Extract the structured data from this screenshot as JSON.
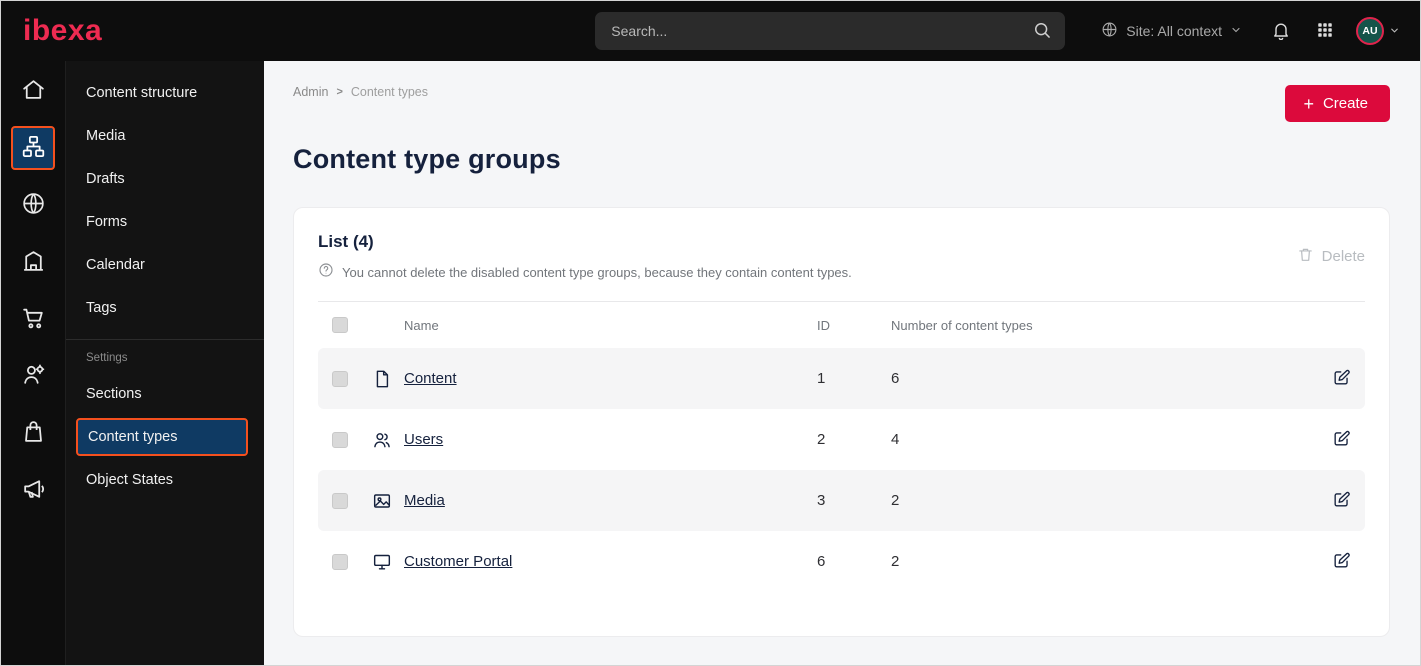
{
  "topbar": {
    "logo_text": "ibexa",
    "search_placeholder": "Search...",
    "site_context_label": "Site: All context",
    "avatar_initials": "AU"
  },
  "rail": {
    "items": [
      {
        "icon": "home-icon",
        "selected": false
      },
      {
        "icon": "content-structure-icon",
        "selected": true
      },
      {
        "icon": "site-globe-icon",
        "selected": false
      },
      {
        "icon": "admin-building-icon",
        "selected": false
      },
      {
        "icon": "commerce-cart-icon",
        "selected": false
      },
      {
        "icon": "customers-icon",
        "selected": false
      },
      {
        "icon": "products-icon",
        "selected": false
      },
      {
        "icon": "marketing-megaphone-icon",
        "selected": false
      }
    ]
  },
  "sidebar": {
    "items": [
      {
        "label": "Content structure"
      },
      {
        "label": "Media"
      },
      {
        "label": "Drafts"
      },
      {
        "label": "Forms"
      },
      {
        "label": "Calendar"
      },
      {
        "label": "Tags"
      }
    ],
    "settings_heading": "Settings",
    "settings_items": [
      {
        "label": "Sections",
        "selected": false
      },
      {
        "label": "Content types",
        "selected": true
      },
      {
        "label": "Object States",
        "selected": false
      }
    ]
  },
  "main": {
    "breadcrumb": {
      "root": "Admin",
      "separator": ">",
      "current": "Content types"
    },
    "create_button": "Create",
    "page_title": "Content type groups",
    "card": {
      "list_heading": "List (4)",
      "info_note": "You cannot delete the disabled content type groups, because they contain content types.",
      "delete_button": "Delete",
      "table": {
        "headers": {
          "name": "Name",
          "id": "ID",
          "count": "Number of content types"
        },
        "rows": [
          {
            "icon": "content-file-icon",
            "name": "Content",
            "id": "1",
            "count": "6"
          },
          {
            "icon": "users-icon",
            "name": "Users",
            "id": "2",
            "count": "4"
          },
          {
            "icon": "media-image-icon",
            "name": "Media",
            "id": "3",
            "count": "2"
          },
          {
            "icon": "customer-portal-monitor-icon",
            "name": "Customer Portal",
            "id": "6",
            "count": "2"
          }
        ]
      }
    }
  },
  "colors": {
    "brand_red": "#ee2b51",
    "primary_button_red": "#dc0a3c",
    "selected_highlight_border": "#f4501e",
    "selected_item_background": "#0f3a63",
    "topbar_background": "#0d0d0d"
  }
}
